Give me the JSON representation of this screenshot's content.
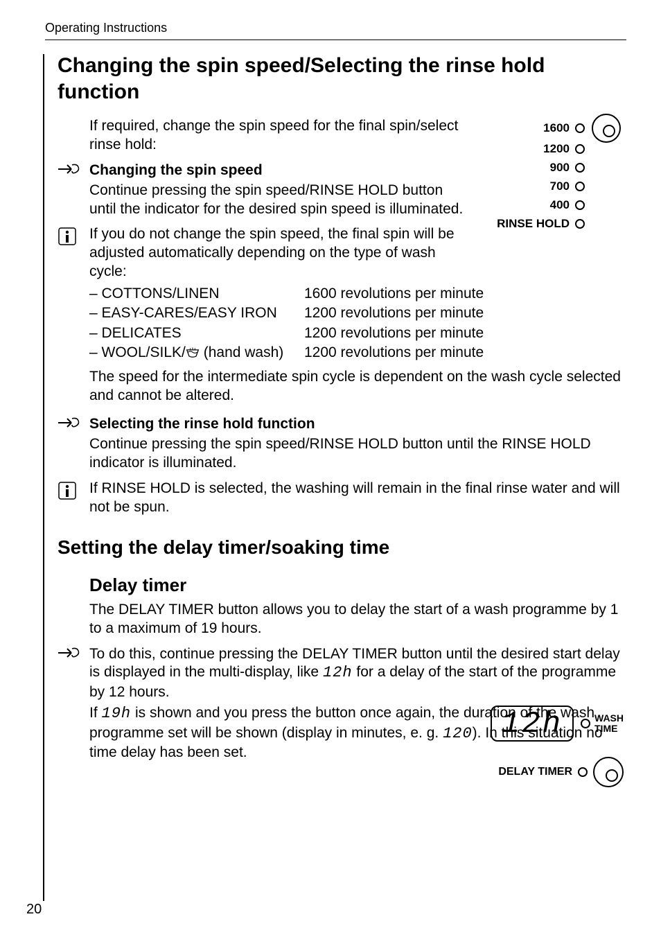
{
  "header": "Operating Instructions",
  "page_number": "20",
  "h1": "Changing the spin speed/Selecting the rinse hold function",
  "intro": "If required, change the spin speed for the final spin/select rinse hold:",
  "change_speed": {
    "title": "Changing the spin speed",
    "text": "Continue pressing the spin speed/RINSE HOLD button until the indicator for the desired spin speed is illuminated."
  },
  "info_spin": "If you do not change the spin speed, the final spin will be adjusted automatically depending on the type of wash cycle:",
  "cycles": {
    "names": [
      "– COTTONS/LINEN",
      "– EASY-CARES/EASY IRON",
      "– DELICATES"
    ],
    "handwash_prefix": "– WOOL/SILK/",
    "handwash_suffix": " (hand wash)",
    "rpm": [
      "1600 revolutions per minute",
      "1200 revolutions per minute",
      "1200 revolutions per minute",
      "1200 revolutions per minute"
    ]
  },
  "intermediate": "The speed for the intermediate spin cycle is dependent on the wash cycle selected and cannot be altered.",
  "rinse_hold": {
    "title": "Selecting the rinse hold function",
    "text": "Continue pressing the spin speed/RINSE HOLD button until the RINSE HOLD indicator is illuminated."
  },
  "info_rinse": "If RINSE HOLD is selected, the washing will remain in the final rinse water and will not be spun.",
  "h2": "Setting the delay timer/soaking time",
  "h3": "Delay timer",
  "delay_para1": "The DELAY TIMER button allows you to delay the start of a wash programme by 1 to a maximum of 19 hours.",
  "delay_pre": "To do this, continue pressing the DELAY TIMER button until the desired start delay is displayed in the multi-display, like ",
  "seg12": "12h",
  "delay_mid": " for a delay of the start of the programme by 12 hours.",
  "delay_if": "If ",
  "seg19": "19h",
  "delay_after19": " is shown and you press the button once again, the duration of the wash programme set will be shown (display in minutes, e. g. ",
  "seg120": "120",
  "delay_end": "). In this situation no time delay has been set.",
  "speed_panel": {
    "speeds": [
      "1600",
      "1200",
      "900",
      "700",
      "400"
    ],
    "rinse_hold": "RINSE HOLD"
  },
  "delay_panel": {
    "display": "12h",
    "wash": "WASH",
    "time": "TIME",
    "btn_label": "DELAY TIMER"
  }
}
